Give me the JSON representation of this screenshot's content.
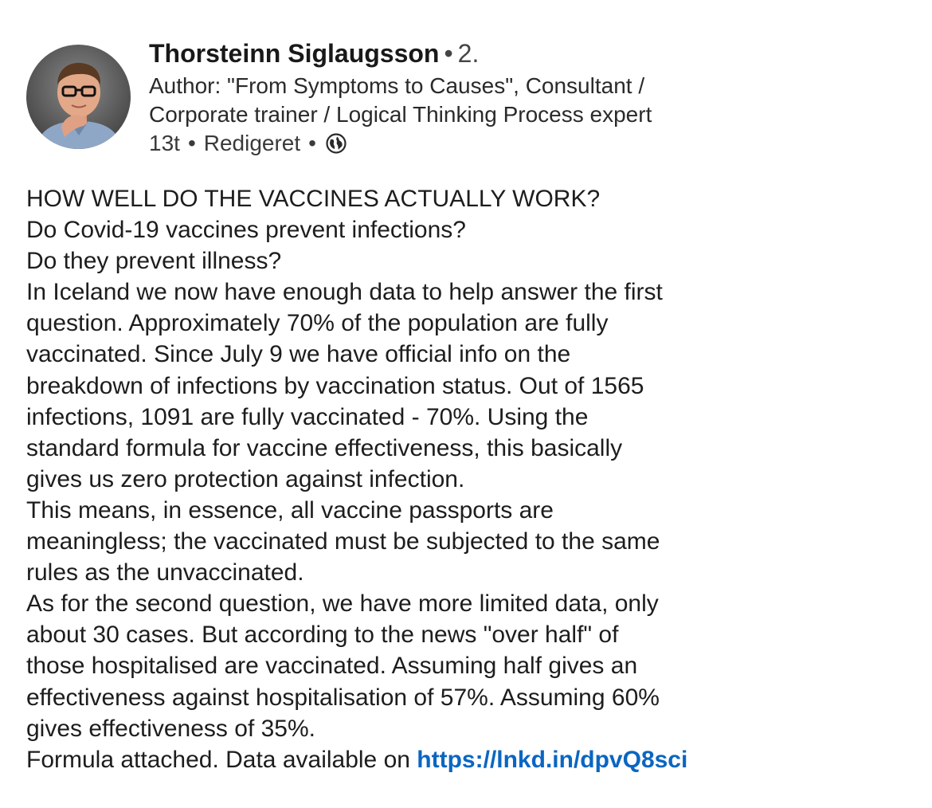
{
  "author": {
    "name": "Thorsteinn Siglaugsson",
    "separator": "•",
    "degree": "2.",
    "headline_lines": [
      "Author: \"From Symptoms to Causes\", Consultant /",
      "Corporate trainer / Logical Thinking Process expert"
    ],
    "time": "13t",
    "edited": "Redigeret",
    "visibility_icon": "globe-icon"
  },
  "post": {
    "lines": [
      "HOW WELL DO THE VACCINES ACTUALLY WORK?",
      "Do Covid-19 vaccines prevent infections?",
      "Do they prevent illness?",
      "In Iceland we now have enough data to help answer the first",
      "question. Approximately 70% of the population are fully",
      "vaccinated. Since July 9 we have official info on the",
      "breakdown of infections by vaccination status. Out of 1565",
      "infections, 1091 are fully vaccinated - 70%. Using the",
      "standard formula for vaccine effectiveness, this basically",
      "gives us zero protection against infection.",
      "This means, in essence, all vaccine passports are",
      "meaningless; the vaccinated must be subjected to the same",
      "rules as the unvaccinated.",
      "As for the second question, we have more limited data, only",
      "about 30 cases. But according to the news \"over half\" of",
      "those hospitalised are vaccinated. Assuming half gives an",
      "effectiveness against hospitalisation of 57%. Assuming 60%",
      "gives effectiveness of 35%."
    ],
    "last_line_prefix": "Formula attached. Data available on ",
    "link_text": "https://lnkd.in/dpvQ8sci"
  },
  "colors": {
    "link": "#0a66c2",
    "text": "#1d1d1d"
  }
}
